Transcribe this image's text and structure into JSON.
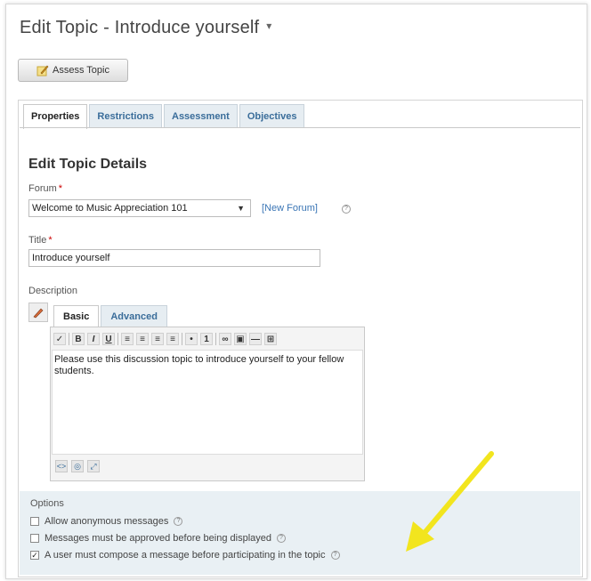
{
  "page": {
    "title": "Edit Topic - Introduce yourself",
    "title_caret": "▾"
  },
  "toolbar": {
    "assess_label": "Assess Topic"
  },
  "tabs": [
    {
      "label": "Properties",
      "active": true
    },
    {
      "label": "Restrictions",
      "active": false
    },
    {
      "label": "Assessment",
      "active": false
    },
    {
      "label": "Objectives",
      "active": false
    }
  ],
  "form": {
    "section_title": "Edit Topic Details",
    "forum_label": "Forum",
    "forum_value": "Welcome to Music Appreciation 101",
    "new_forum_link": "[New Forum]",
    "title_label": "Title",
    "title_value": "Introduce yourself",
    "description_label": "Description"
  },
  "editor": {
    "tabs": [
      {
        "label": "Basic",
        "active": true
      },
      {
        "label": "Advanced",
        "active": false
      }
    ],
    "content": "Please use this discussion topic to introduce yourself to your fellow students."
  },
  "options": {
    "title": "Options",
    "items": [
      {
        "label": "Allow anonymous messages",
        "checked": false
      },
      {
        "label": "Messages must be approved before being displayed",
        "checked": false
      },
      {
        "label": "A user must compose a message before participating in the topic",
        "checked": true
      }
    ]
  },
  "colors": {
    "link": "#3a75b5",
    "tab_inactive": "#e6edf2",
    "options_bg": "#e9f0f4",
    "annotation_arrow": "#f2e51e"
  }
}
